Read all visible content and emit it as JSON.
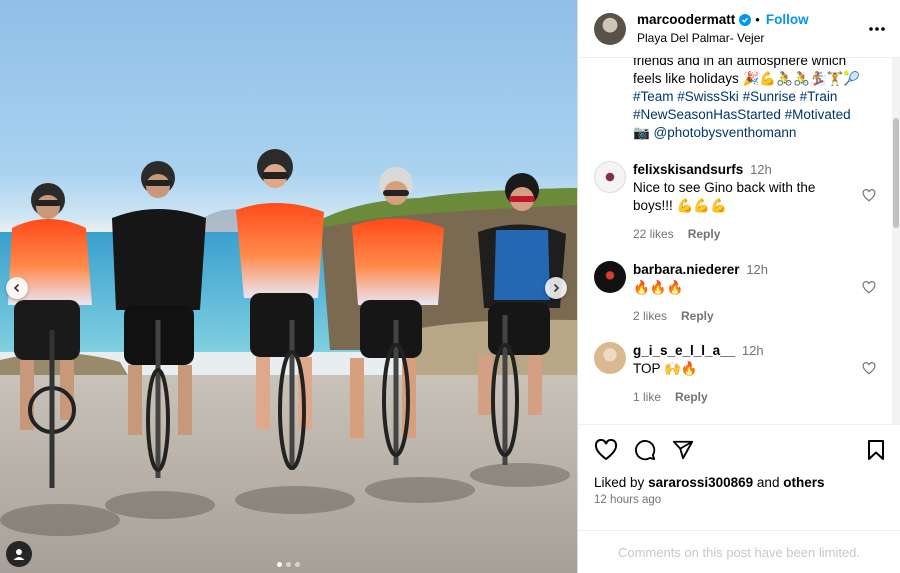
{
  "post": {
    "owner": "marcoodermatt",
    "follow_label": "Follow",
    "location": "Playa Del Palmar- Vejer",
    "caption_lines": [
      "friends and in an atmosphere which",
      "feels like holidays 🎉💪🚴🚴🏂🏋️🎾"
    ],
    "hashtags": [
      "#Team",
      "#SwissSki",
      "#Sunrise",
      "#Train",
      "#NewSeasonHasStarted",
      "#Motivated"
    ],
    "photo_credit": "📷 @photobysventhomann"
  },
  "comments": [
    {
      "user": "felixskisandsurfs",
      "time": "12h",
      "text": "Nice to see Gino back with the boys!!! 💪💪💪",
      "likes": "22 likes",
      "reply": "Reply"
    },
    {
      "user": "barbara.niederer",
      "time": "12h",
      "text": "🔥🔥🔥",
      "likes": "2 likes",
      "reply": "Reply"
    },
    {
      "user": "g_i_s_e_l_l_a__",
      "time": "12h",
      "text": "TOP 🙌🔥",
      "likes": "1 like",
      "reply": "Reply"
    }
  ],
  "actions": {
    "liked_prefix": "Liked by",
    "liked_user": "sararossi300869",
    "liked_and": "and",
    "liked_others": "others",
    "timestamp": "12 hours ago"
  },
  "footer": {
    "comments_limited": "Comments on this post have been limited."
  },
  "colors": {
    "accent": "#0095f6",
    "link": "#00376b",
    "jersey_orange": "#ff5a1f"
  },
  "icons": [
    "more-options-icon",
    "verified-icon",
    "heart-icon",
    "comment-icon",
    "share-icon",
    "bookmark-icon",
    "chevron-left-icon",
    "chevron-right-icon",
    "user-tag-icon"
  ]
}
